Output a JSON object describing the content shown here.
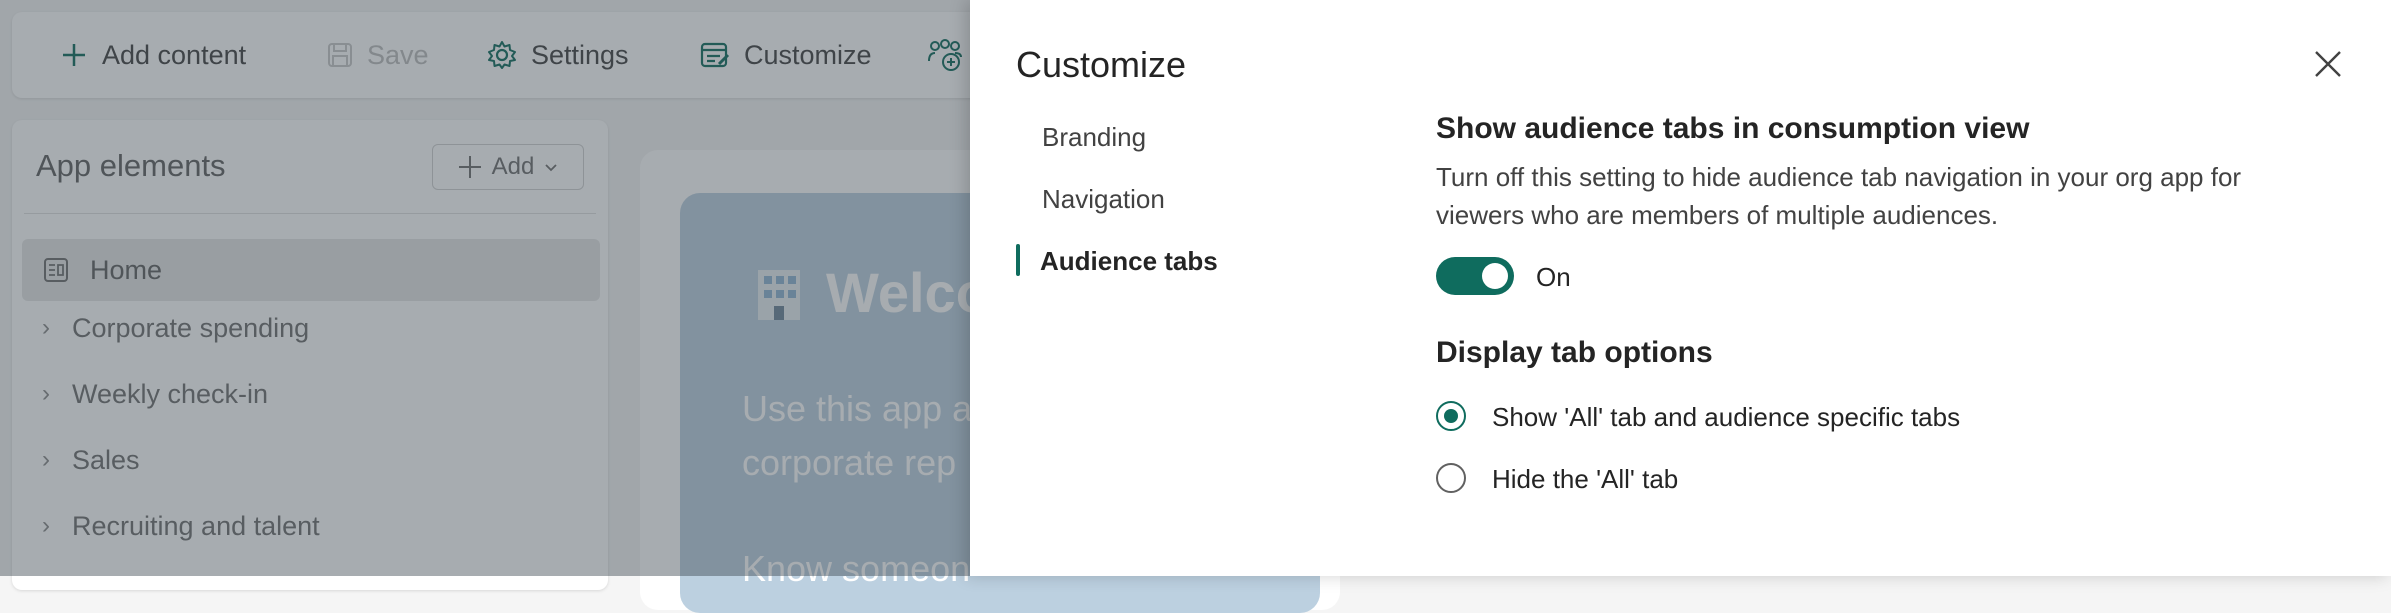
{
  "toolbar": {
    "add_content": "Add content",
    "save": "Save",
    "settings": "Settings",
    "customize": "Customize"
  },
  "left_panel": {
    "header": "App elements",
    "add_button": "Add",
    "items": [
      {
        "label": "Home",
        "selected": true
      },
      {
        "label": "Corporate spending"
      },
      {
        "label": "Weekly check-in"
      },
      {
        "label": "Sales"
      },
      {
        "label": "Recruiting and talent"
      }
    ]
  },
  "canvas": {
    "hero_title": "Welco",
    "hero_line1": "Use this app a",
    "hero_line2": "corporate rep",
    "hero_line3": "Know someon"
  },
  "dialog": {
    "title": "Customize",
    "tabs": [
      {
        "label": "Branding",
        "active": false
      },
      {
        "label": "Navigation",
        "active": false
      },
      {
        "label": "Audience tabs",
        "active": true
      }
    ],
    "show_audience_tabs": {
      "title": "Show audience tabs in consumption view",
      "description": "Turn off this setting to hide audience tab navigation in your org app for viewers who are members of multiple audiences.",
      "toggle_state": "On",
      "toggle_on": true
    },
    "display_options": {
      "title": "Display tab options",
      "options": [
        {
          "label": "Show 'All' tab and audience specific tabs",
          "checked": true
        },
        {
          "label": "Hide the 'All' tab",
          "checked": false
        }
      ]
    }
  },
  "colors": {
    "accent": "#0f6c5e",
    "overlay": "#3c4650"
  }
}
